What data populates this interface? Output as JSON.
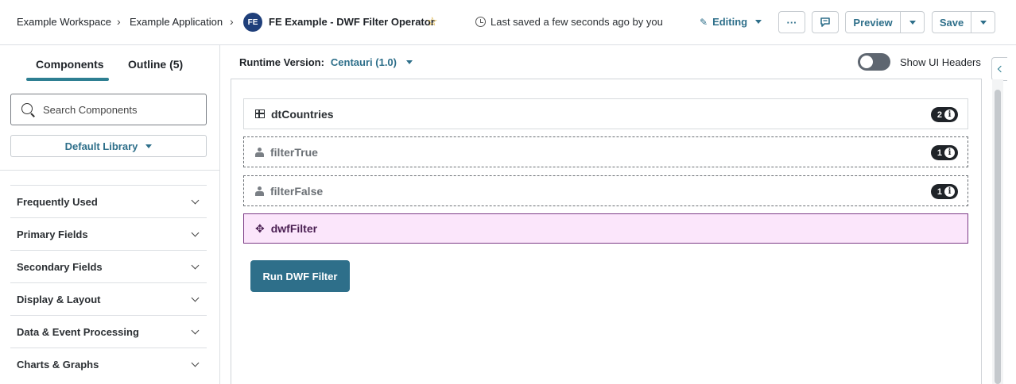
{
  "header": {
    "breadcrumbs": [
      "Example Workspace",
      "Example Application"
    ],
    "app_initials": "FE",
    "app_title": "FE Example - DWF Filter Operator",
    "saved_status": "Last saved a few seconds ago by you",
    "mode": "Editing",
    "more_label": "···",
    "preview_label": "Preview",
    "save_label": "Save"
  },
  "sidebar": {
    "tabs": [
      "Components",
      "Outline (5)"
    ],
    "search_placeholder": "Search Components",
    "library": "Default Library",
    "sections": [
      "Frequently Used",
      "Primary Fields",
      "Secondary Fields",
      "Display & Layout",
      "Data & Event Processing",
      "Charts & Graphs"
    ]
  },
  "main": {
    "runtime_label": "Runtime Version:",
    "runtime_value": "Centauri (1.0)",
    "show_headers_label": "Show UI Headers",
    "components": [
      {
        "name": "dtCountries",
        "count": "2"
      },
      {
        "name": "filterTrue",
        "count": "1"
      },
      {
        "name": "filterFalse",
        "count": "1"
      },
      {
        "name": "dwfFilter"
      }
    ],
    "run_button": "Run DWF Filter"
  },
  "colors": {
    "accent": "#2e6f8a",
    "selected_bg": "#fbe6fb",
    "selected_border": "#7c3c86",
    "badge": "#1f2328"
  }
}
